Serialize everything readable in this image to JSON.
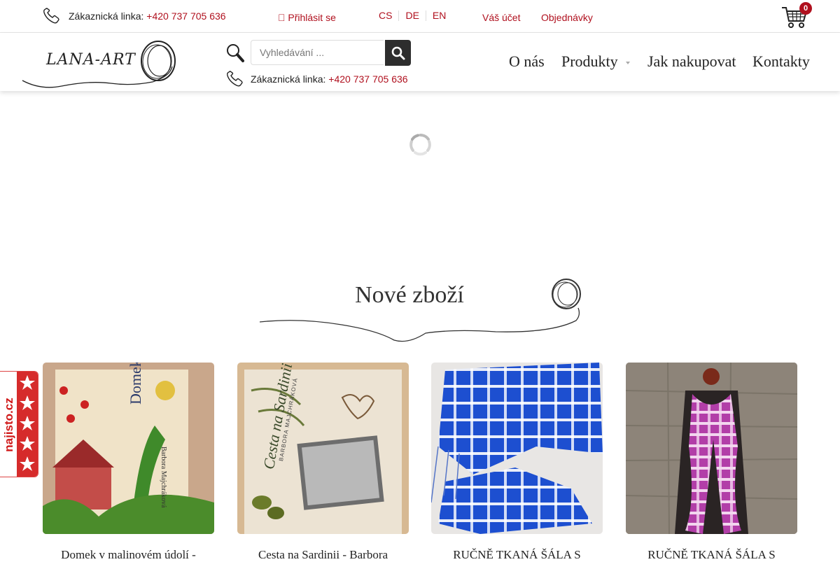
{
  "topbar": {
    "hotline_label": "Zákaznická linka:",
    "hotline_number": "+420 737 705 636",
    "login": "\u0000 Přihlásit se",
    "languages": [
      "CS",
      "DE",
      "EN"
    ],
    "account": "Váš účet",
    "orders": "Objednávky",
    "cart_count": "0"
  },
  "header": {
    "logo_text": "LANA-ART",
    "search_placeholder": "Vyhledávání ...",
    "hotline_label": "Zákaznická linka:",
    "hotline_number": "+420 737 705 636",
    "nav": [
      "O nás",
      "Produkty",
      "Jak nakupovat",
      "Kontakty"
    ]
  },
  "new_goods": {
    "title": "Nové zboží",
    "products": [
      {
        "name": "Domek v malinovém údolí -",
        "cover_title": "Domek v malinovém údolí",
        "cover_author": "Barbora Majchráková"
      },
      {
        "name": "Cesta na Sardinii - Barbora",
        "cover_title": "Cesta na Sardinii",
        "cover_author": "BARBORA MAJCHRÁKOVÁ"
      },
      {
        "name": "RUČNĚ TKANÁ ŠÁLA S"
      },
      {
        "name": "RUČNĚ TKANÁ ŠÁLA S"
      }
    ]
  },
  "badge": {
    "najisto": "najisto.cz"
  },
  "colors": {
    "accent": "#b0101e",
    "search_button": "#2d2d2d"
  }
}
